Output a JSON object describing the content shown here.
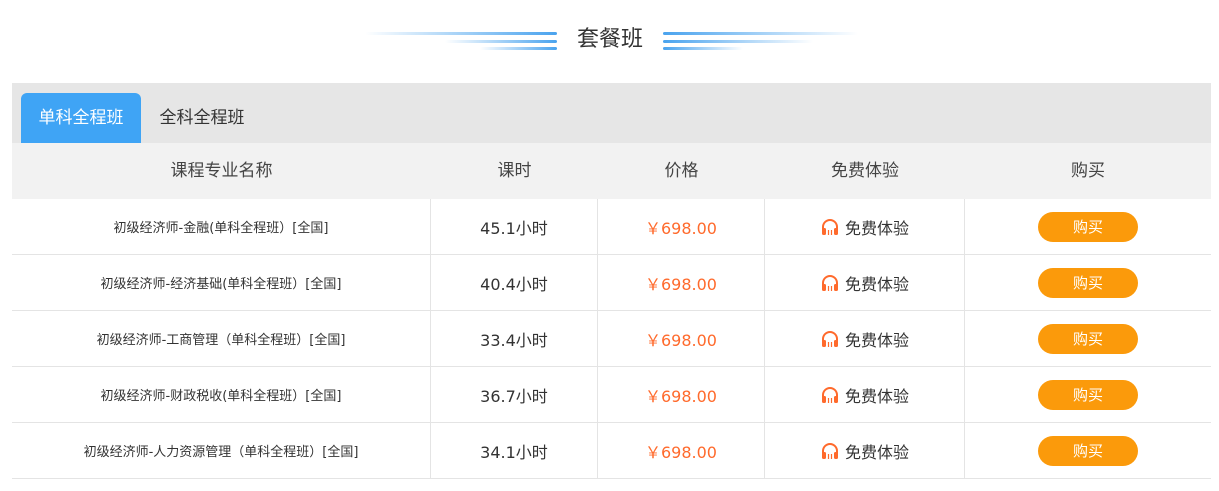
{
  "section": {
    "title": "套餐班"
  },
  "tabs": [
    {
      "label": "单科全程班",
      "active": true
    },
    {
      "label": "全科全程班",
      "active": false
    }
  ],
  "table": {
    "headers": [
      "课程专业名称",
      "课时",
      "价格",
      "免费体验",
      "购买"
    ],
    "rows": [
      {
        "name": "初级经济师-金融(单科全程班）[全国]",
        "hours": "45.1小时",
        "price": "￥698.00",
        "trial": "免费体验",
        "buy": "购买"
      },
      {
        "name": "初级经济师-经济基础(单科全程班）[全国]",
        "hours": "40.4小时",
        "price": "￥698.00",
        "trial": "免费体验",
        "buy": "购买"
      },
      {
        "name": "初级经济师-工商管理（单科全程班）[全国]",
        "hours": "33.4小时",
        "price": "￥698.00",
        "trial": "免费体验",
        "buy": "购买"
      },
      {
        "name": "初级经济师-财政税收(单科全程班）[全国]",
        "hours": "36.7小时",
        "price": "￥698.00",
        "trial": "免费体验",
        "buy": "购买"
      },
      {
        "name": "初级经济师-人力资源管理（单科全程班）[全国]",
        "hours": "34.1小时",
        "price": "￥698.00",
        "trial": "免费体验",
        "buy": "购买"
      }
    ]
  },
  "icons": {
    "trial": "headphones-icon"
  },
  "colors": {
    "accent": "#3fa4f5",
    "price": "#ff6a2c",
    "buy_button": "#fb9a0b",
    "tabbar_bg": "#e6e6e6",
    "header_bg": "#f2f2f2"
  }
}
